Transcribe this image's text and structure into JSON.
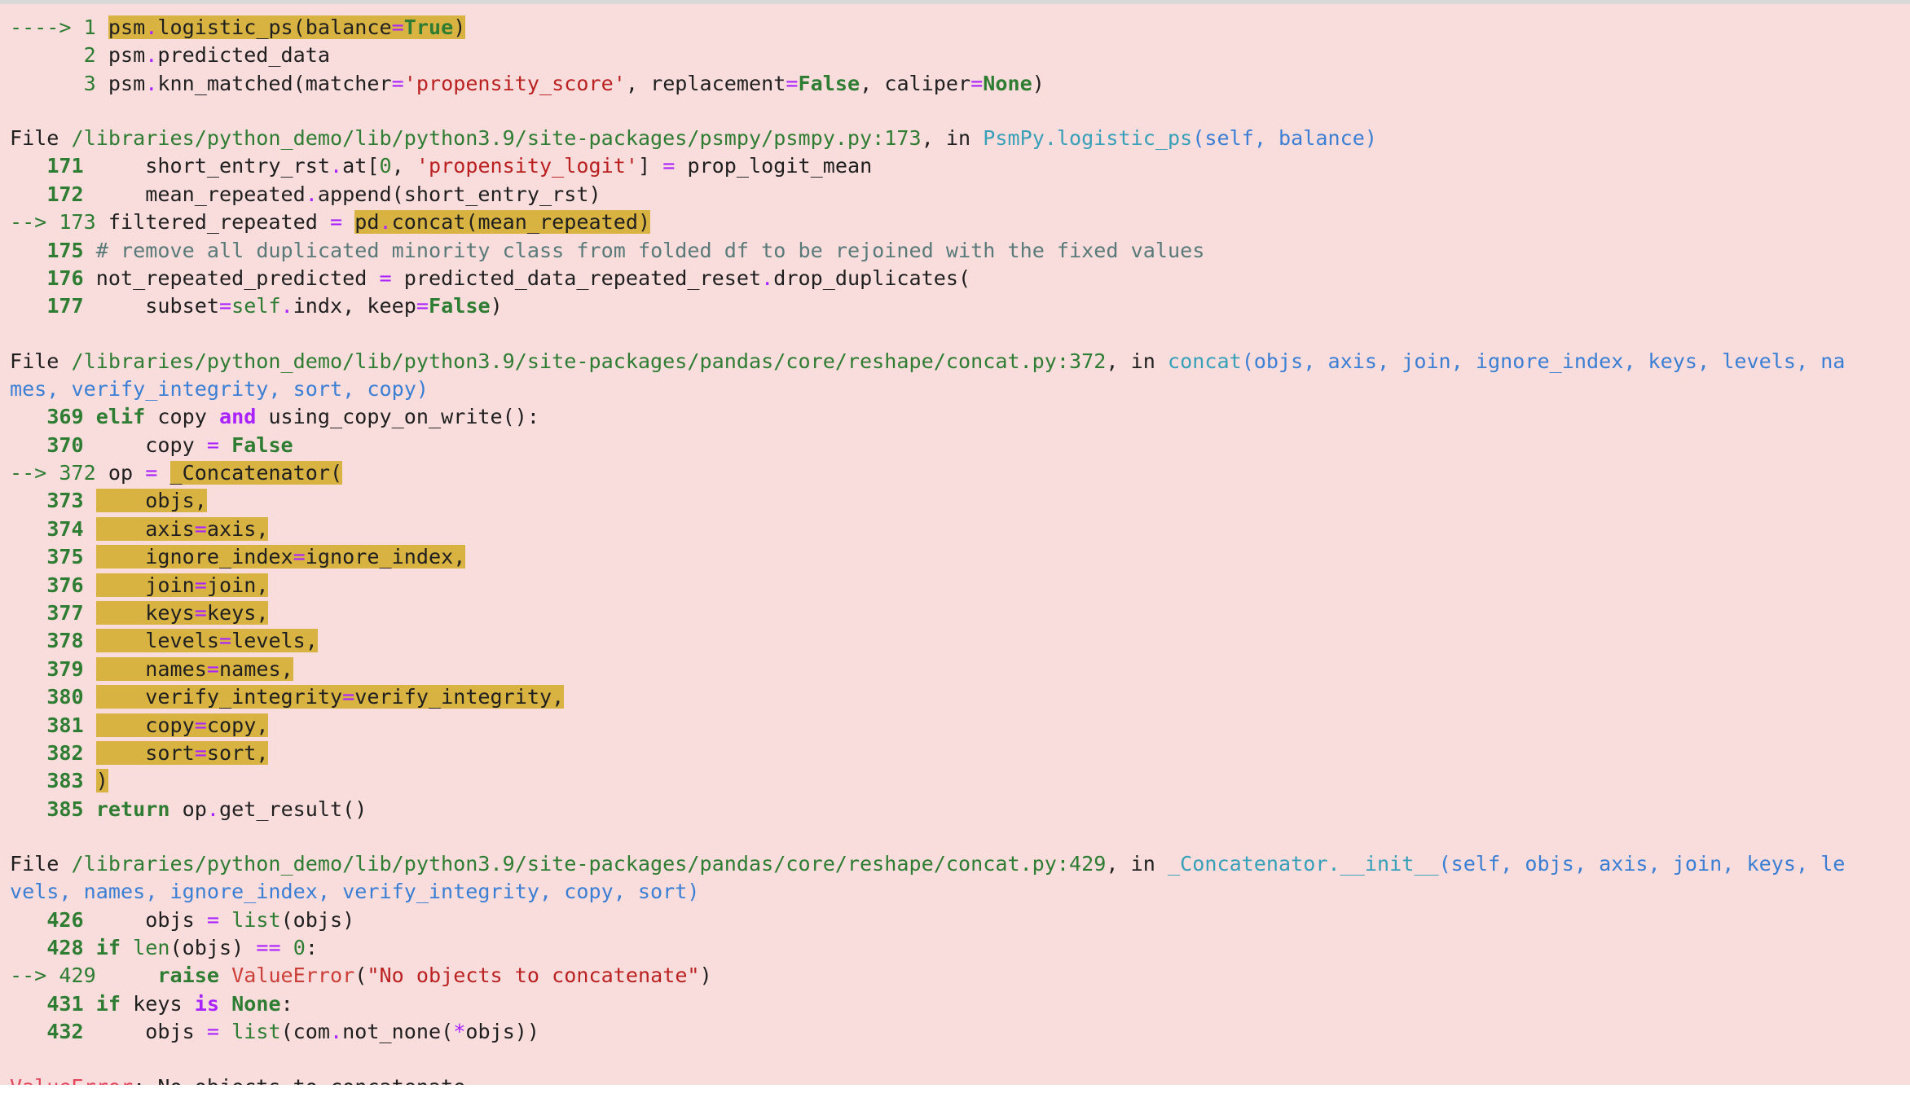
{
  "traceback": {
    "top_frame": {
      "arrow_marker": "----> 1",
      "line_numbers": [
        "1",
        "2",
        "3"
      ],
      "call_1": "psm.logistic_ps(balance=True)",
      "call_2": "psm.predicted_data",
      "call_3": "psm.knn_matched(matcher='propensity_score', replacement=False, caliper=None)"
    },
    "frames": [
      {
        "file_label": "File",
        "path": "/libraries/python_demo/lib/python3.9/site-packages/psmpy/psmpy.py:173",
        "in_text": ", in",
        "func": "PsmPy.logistic_ps",
        "signature": "(self, balance)"
      },
      {
        "file_label": "File",
        "path": "/libraries/python_demo/lib/python3.9/site-packages/pandas/core/reshape/concat.py:372",
        "in_text": ", in",
        "func": "concat",
        "signature": "(objs, axis, join, ignore_index, keys, levels, na",
        "signature_cont": "mes, verify_integrity, sort, copy)"
      },
      {
        "file_label": "File",
        "path": "/libraries/python_demo/lib/python3.9/site-packages/pandas/core/reshape/concat.py:429",
        "in_text": ", in",
        "func": "_Concatenator.__init__",
        "signature": "(self, objs, axis, join, keys, le",
        "signature_cont": "vels, names, ignore_index, verify_integrity, copy, sort)"
      }
    ],
    "error": {
      "name": "ValueError",
      "message": ": No objects to concatenate"
    }
  }
}
